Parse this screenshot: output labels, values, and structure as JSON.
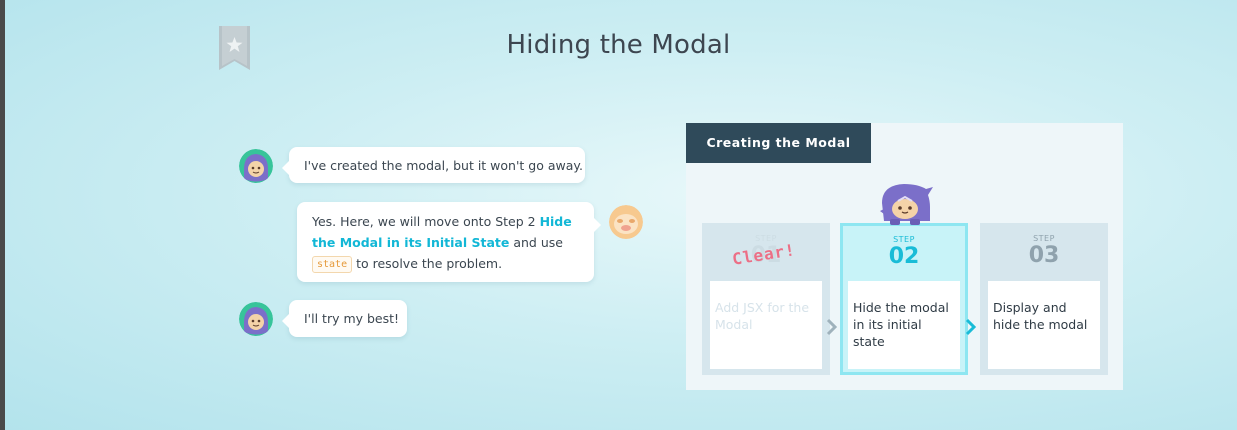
{
  "page": {
    "title": "Hiding the Modal"
  },
  "chat": [
    {
      "speaker": "student",
      "text": "I've created the modal, but it won't go away."
    },
    {
      "speaker": "teacher",
      "part1": "Yes. Here, we will move onto Step 2 ",
      "highlight": "Hide the Modal in its Initial State",
      "part2": " and use",
      "code": "state",
      "part3": "to resolve the problem."
    },
    {
      "speaker": "student",
      "text": "I'll try my best!"
    }
  ],
  "panel": {
    "header": "Creating the Modal",
    "steps": [
      {
        "label": "STEP",
        "number": "01",
        "text": "Add JSX for the Modal",
        "status": "done",
        "badge": "Clear!"
      },
      {
        "label": "STEP",
        "number": "02",
        "text": "Hide the modal in its initial state",
        "status": "active"
      },
      {
        "label": "STEP",
        "number": "03",
        "text": "Display and hide the modal",
        "status": "upcoming"
      }
    ]
  },
  "colors": {
    "accent": "#12b7d6",
    "header_bg": "#2f4a5a",
    "clear_badge": "#ec6f86"
  },
  "icons": [
    "bookmark-star-icon",
    "student-avatar",
    "teacher-avatar",
    "mascot-character",
    "chevron-right-icon"
  ]
}
